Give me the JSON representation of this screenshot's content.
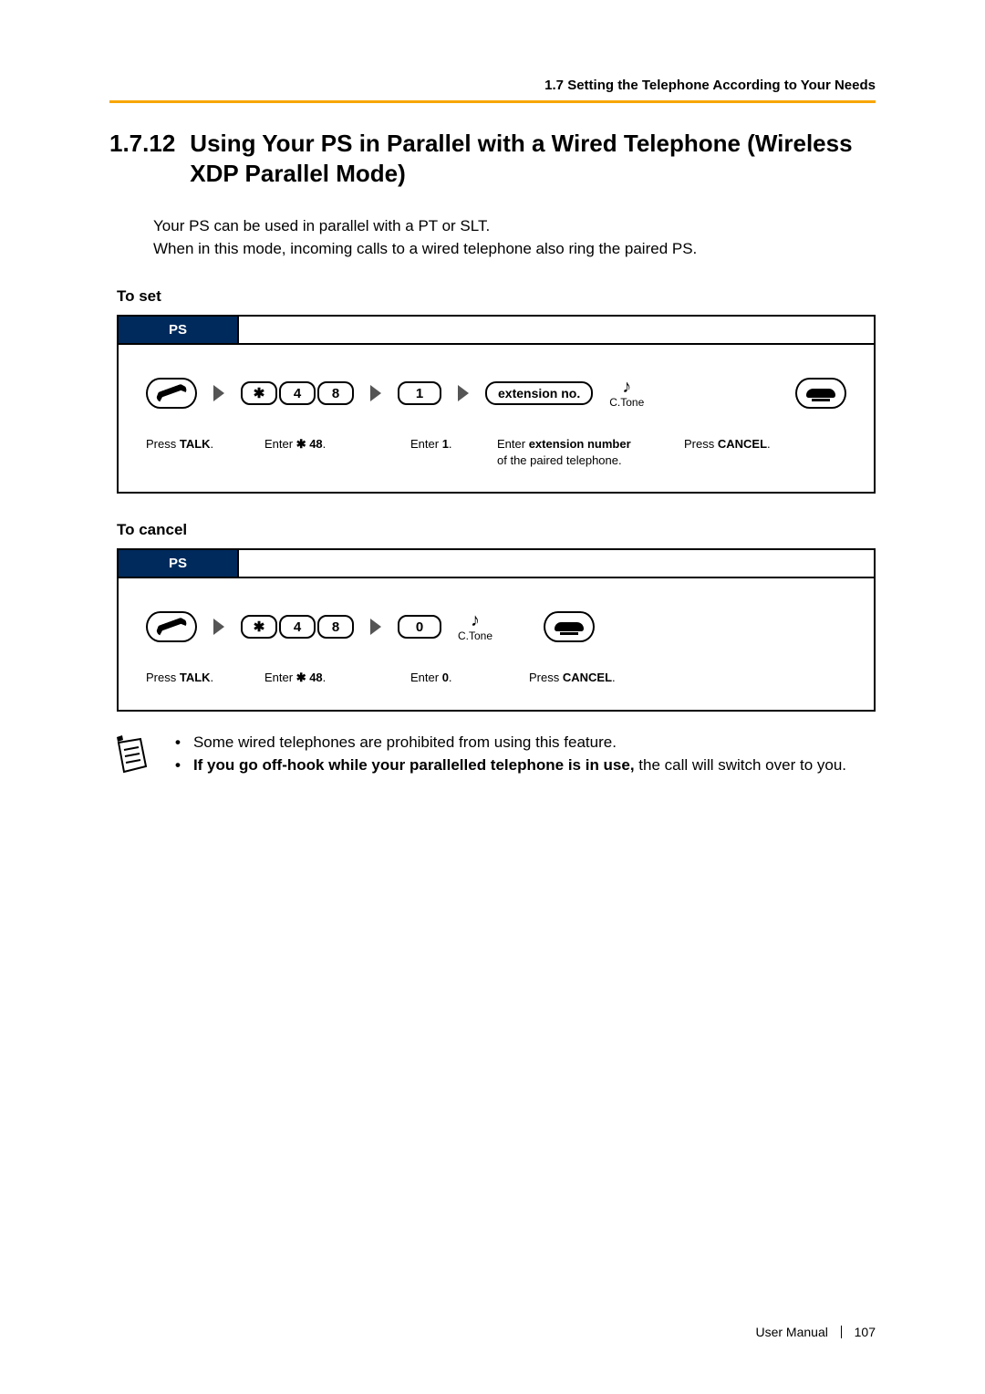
{
  "running_head": "1.7 Setting the Telephone According to Your Needs",
  "section": {
    "number": "1.7.12",
    "title": "Using Your PS in Parallel with a Wired Telephone (Wireless XDP Parallel Mode)"
  },
  "intro": {
    "line1": "Your PS can be used in parallel with a PT or SLT.",
    "line2": "When in this mode, incoming calls to a wired telephone also ring the paired PS."
  },
  "to_set": {
    "heading": "To set",
    "tab": "PS",
    "keys": {
      "star": "✱",
      "k4": "4",
      "k8": "8",
      "k1": "1"
    },
    "ext_label": "extension no.",
    "ctone": "C.Tone",
    "labels": {
      "talk_pre": "Press ",
      "talk_b": "TALK",
      "talk_post": ".",
      "code_pre": "Enter ",
      "code_b": "✱ 48",
      "code_post": ".",
      "one_pre": "Enter ",
      "one_b": "1",
      "one_post": ".",
      "ext_pre": "Enter ",
      "ext_b": "extension number",
      "ext_post": " of the paired telephone.",
      "cancel_pre": "Press ",
      "cancel_b": "CANCEL",
      "cancel_post": "."
    }
  },
  "to_cancel": {
    "heading": "To cancel",
    "tab": "PS",
    "keys": {
      "star": "✱",
      "k4": "4",
      "k8": "8",
      "k0": "0"
    },
    "ctone": "C.Tone",
    "labels": {
      "talk_pre": "Press ",
      "talk_b": "TALK",
      "talk_post": ".",
      "code_pre": "Enter ",
      "code_b": "✱ 48",
      "code_post": ".",
      "zero_pre": "Enter ",
      "zero_b": "0",
      "zero_post": ".",
      "cancel_pre": "Press ",
      "cancel_b": "CANCEL",
      "cancel_post": "."
    }
  },
  "notes": {
    "n1": "Some wired telephones are prohibited from using this feature.",
    "n2_b": "If you go off-hook while your parallelled telephone is in use,",
    "n2_rest": " the call will switch over to you."
  },
  "footer": {
    "label": "User Manual",
    "page": "107"
  }
}
